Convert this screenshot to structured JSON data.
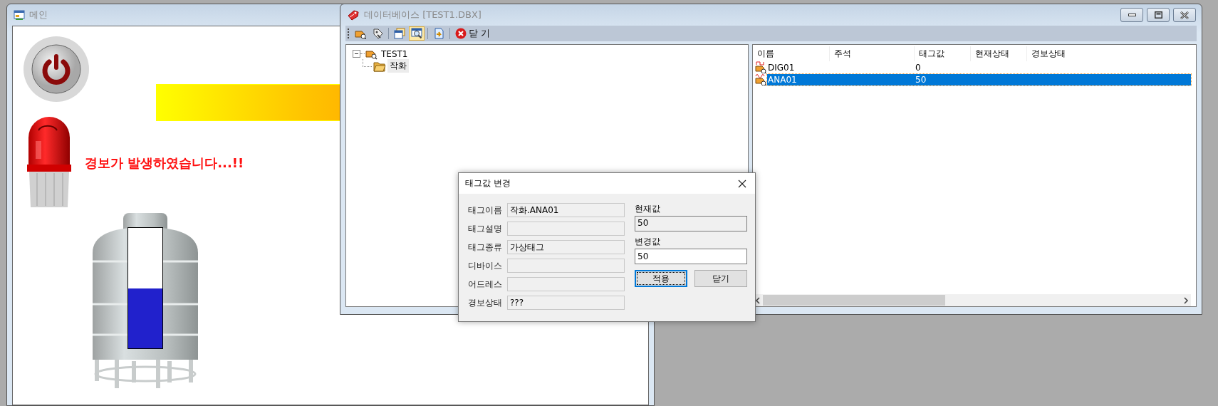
{
  "main_window": {
    "title": "메인",
    "alarm_message": "경보가 발생하였습니다...!!",
    "tank": {
      "level": 0.5
    }
  },
  "database_window": {
    "title": "데이터베이스 [TEST1.DBX]",
    "toolbar": [
      {
        "pressed": false
      },
      {
        "pressed": false
      },
      {
        "pressed": false
      },
      {
        "pressed": true
      },
      {
        "pressed": false
      },
      {
        "label": "닫 기",
        "pressed": false
      }
    ],
    "tree": [
      {
        "label": "TEST1",
        "expanded": true,
        "selected": false,
        "children": [
          {
            "label": "작화",
            "selected": true
          }
        ]
      }
    ],
    "list": {
      "columns": [
        "이름",
        "주석",
        "태그값",
        "현재상태",
        "경보상태"
      ],
      "rows": [
        {
          "kind": "digital",
          "name": "DIG01",
          "value": "0",
          "selected": false
        },
        {
          "kind": "analog",
          "name": "ANA01",
          "value": "50",
          "selected": true
        }
      ]
    }
  },
  "dialog": {
    "title": "태그값 변경",
    "fields": [
      {
        "label": "태그이름",
        "value": "작화.ANA01"
      },
      {
        "label": "태그설명"
      },
      {
        "label": "태그종류",
        "value": "가상태그"
      },
      {
        "label": "디바이스"
      },
      {
        "label": "어드레스"
      },
      {
        "label": "경보상태",
        "value": "???"
      }
    ],
    "current_value": {
      "label": "현재값",
      "value": "50"
    },
    "new_value": {
      "label": "변경값",
      "value": "50"
    },
    "buttons": [
      {
        "label": "적용",
        "focused": true
      },
      {
        "label": "닫기",
        "focused": false
      }
    ]
  }
}
